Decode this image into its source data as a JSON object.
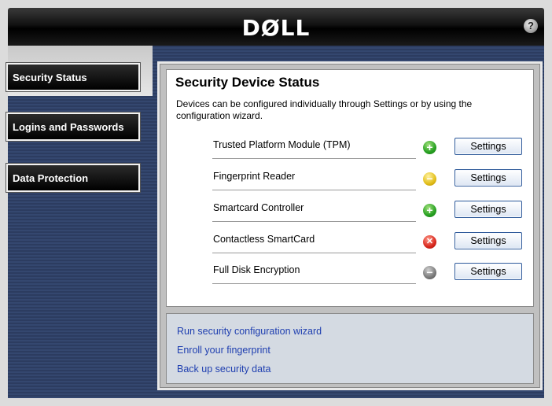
{
  "header": {
    "logo": "DØLL",
    "help_glyph": "?"
  },
  "sidebar": {
    "items": [
      {
        "label": "Security Status"
      },
      {
        "label": "Logins and Passwords"
      },
      {
        "label": "Data Protection"
      }
    ]
  },
  "main": {
    "title": "Security Device Status",
    "description": "Devices can be configured individually through Settings or by using the configuration wizard.",
    "devices": [
      {
        "label": "Trusted Platform Module (TPM)",
        "status": "ok",
        "status_glyph": "+",
        "status_color": "#27a022",
        "button": "Settings"
      },
      {
        "label": "Fingerprint Reader",
        "status": "warning",
        "status_glyph": "−",
        "status_color": "#e2be1a",
        "button": "Settings"
      },
      {
        "label": "Smartcard Controller",
        "status": "ok",
        "status_glyph": "+",
        "status_color": "#27a022",
        "button": "Settings"
      },
      {
        "label": "Contactless SmartCard",
        "status": "error",
        "status_glyph": "✕",
        "status_color": "#d8281e",
        "button": "Settings"
      },
      {
        "label": "Full Disk Encryption",
        "status": "inactive",
        "status_glyph": "−",
        "status_color": "#7a7a7a",
        "button": "Settings"
      }
    ]
  },
  "links": [
    {
      "label": "Run security configuration wizard"
    },
    {
      "label": "Enroll your fingerprint"
    },
    {
      "label": "Back up security data"
    }
  ],
  "colors": {
    "link": "#1f3fb0",
    "sidebar": "#2c3c60",
    "button_border": "#2f5a9a"
  }
}
